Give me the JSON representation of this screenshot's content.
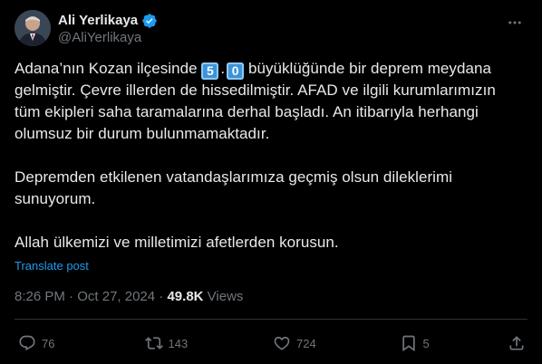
{
  "author": {
    "display_name": "Ali Yerlikaya",
    "handle": "@AliYerlikaya",
    "verified_color": "#1d9bf0"
  },
  "tweet": {
    "line1_before": "Adana’nın Kozan ilçesinde ",
    "digit1": "5",
    "digit_dot": ".",
    "digit2": "0",
    "line1_after": " büyüklüğünde bir deprem meydana gelmiştir.  Çevre illerden de hissedilmiştir. AFAD ve ilgili kurumlarımızın tüm ekipleri saha taramalarına derhal başladı. An itibarıyla herhangi olumsuz bir durum bulunmamaktadır.",
    "paragraph2": "Depremden etkilenen vatandaşlarımıza geçmiş olsun dileklerimi sunuyorum.",
    "paragraph3": "Allah ülkemizi ve milletimizi afetlerden korusun."
  },
  "translate_label": "Translate post",
  "meta": {
    "time": "8:26 PM",
    "separator": " · ",
    "date": "Oct 27, 2024",
    "views_count": "49.8K",
    "views_label": "Views"
  },
  "actions": {
    "replies": "76",
    "reposts": "143",
    "likes": "724",
    "bookmarks": "5"
  },
  "colors": {
    "background": "#000000",
    "text": "#e7e9ea",
    "secondary": "#71767b",
    "accent": "#1d9bf0"
  },
  "icons": [
    "more-icon",
    "verified-icon",
    "reply-icon",
    "repost-icon",
    "like-icon",
    "bookmark-icon",
    "share-icon"
  ]
}
